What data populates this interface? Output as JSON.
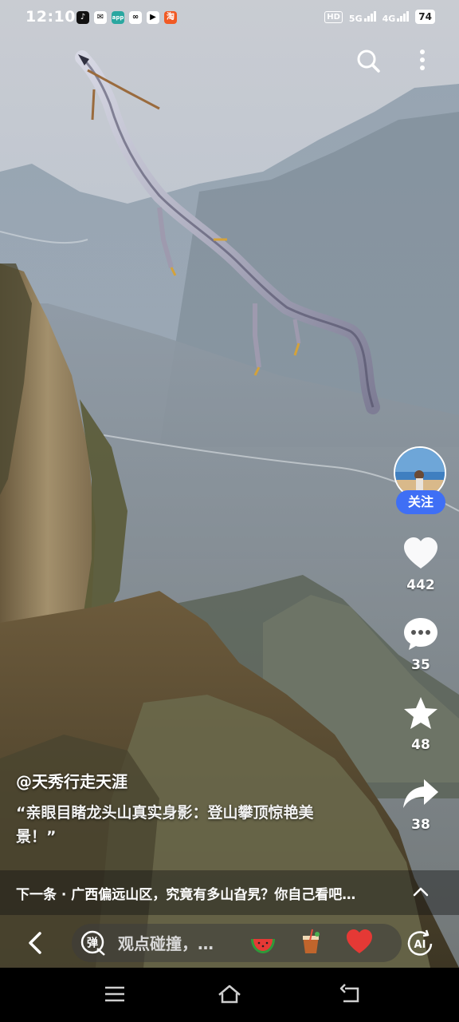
{
  "status_bar": {
    "time": "12:10",
    "network_hd": "HD",
    "network_5g": "5G",
    "network_4g": "4G",
    "battery": "74"
  },
  "top_bar": {
    "icons": [
      "search-icon",
      "more-icon"
    ]
  },
  "creator": {
    "follow_label": "关注"
  },
  "actions": {
    "like_count": "442",
    "comment_count": "35",
    "favorite_count": "48",
    "share_count": "38"
  },
  "caption": {
    "author": "@天秀行走天涯",
    "description": "“亲眼目睹龙头山真实身影：登山攀顶惊艳美景！”"
  },
  "next_video": {
    "text": "下一条 · 广西偏远山区，究竟有多山旮旯？你自己看吧…"
  },
  "comment_bar": {
    "danmu_label": "弹",
    "placeholder": "观点碰撞，…",
    "quick_emojis": [
      "watermelon",
      "drink",
      "heart"
    ],
    "ai_label": "AI"
  },
  "nav_bar": {
    "icons": [
      "menu-icon",
      "home-icon",
      "back-icon"
    ]
  },
  "colors": {
    "follow_button": "#3f6ff5",
    "like_heart": "#ffffff"
  }
}
